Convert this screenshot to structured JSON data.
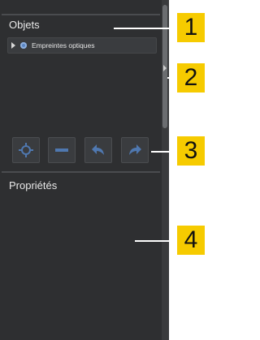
{
  "objects_panel": {
    "title": "Objets",
    "tree": [
      {
        "label": "Empreintes optiques",
        "expanded": false,
        "icon": "scan-object-icon"
      }
    ]
  },
  "toolbar": {
    "buttons": [
      {
        "name": "center-object-button",
        "icon": "crosshair-icon"
      },
      {
        "name": "remove-object-button",
        "icon": "minus-icon"
      },
      {
        "name": "undo-button",
        "icon": "undo-arrow-icon"
      },
      {
        "name": "redo-button",
        "icon": "redo-arrow-icon"
      }
    ]
  },
  "properties_panel": {
    "title": "Propriétés"
  },
  "callouts": [
    "1",
    "2",
    "3",
    "4"
  ],
  "colors": {
    "panel_bg": "#2e2f31",
    "callout_bg": "#f6cb00",
    "icon_blue": "#5a86c4"
  }
}
